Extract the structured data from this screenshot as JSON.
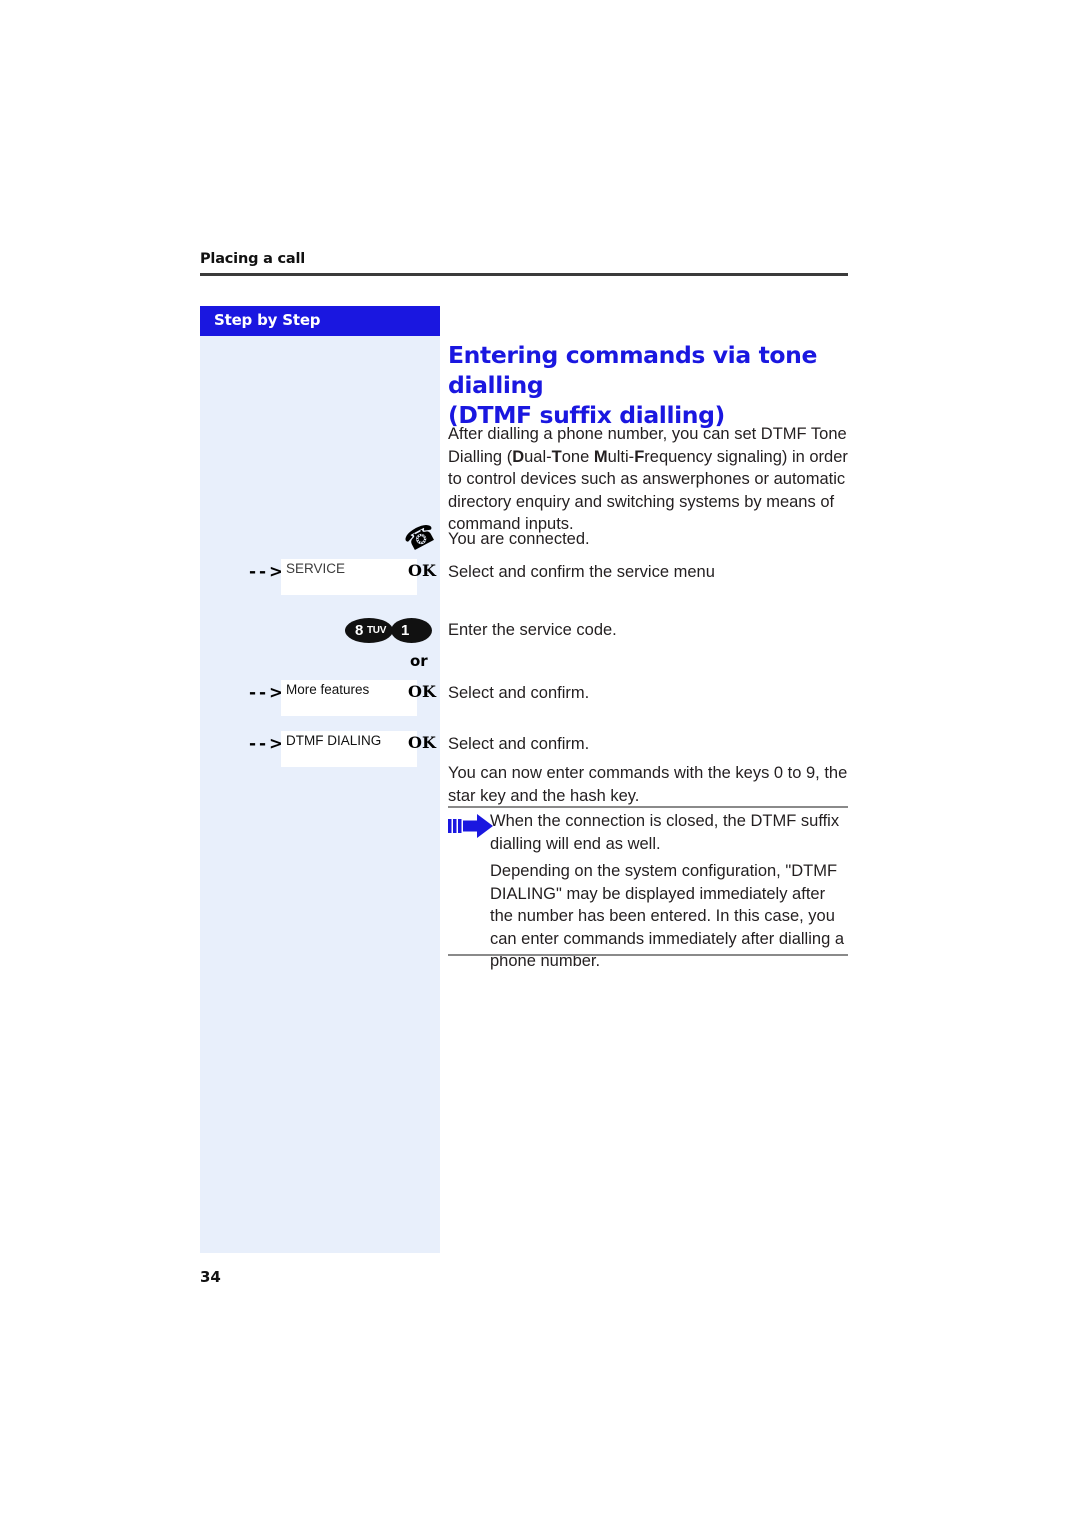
{
  "document": {
    "running_head": "Placing a call",
    "page_number": "34"
  },
  "sidebar": {
    "title": "Step by Step"
  },
  "main": {
    "heading_line1": "Entering commands via tone dialling",
    "heading_line2": "(DTMF suffix dialling)",
    "intro": {
      "line1_a": "After dialling a phone number, you can set DTMF Tone",
      "line2_a": "Dialling (",
      "line2_b": "D",
      "line2_c": "ual-",
      "line2_d": "T",
      "line2_e": "one ",
      "line2_f": "M",
      "line2_g": "ulti-",
      "line2_h": "F",
      "line2_i": "requency signaling) in order",
      "line3": "to control devices such as answerphones or automatic",
      "line4": "directory enquiry and switching systems by means of",
      "line5": "command inputs."
    },
    "closing_paragraph": "You can now enter commands with the keys 0 to 9, the star key and the hash key."
  },
  "steps": [
    {
      "id": "connected",
      "icon": "handset-icon",
      "text": "You are connected."
    },
    {
      "id": "service-menu",
      "select_arrow": "- - >",
      "display_value": "SERVICE",
      "softkey": "OK",
      "text": "Select and confirm the service menu"
    },
    {
      "id": "service-code",
      "keys": [
        {
          "digit": "8",
          "letters": "TUV"
        },
        {
          "digit": "1",
          "letters": ""
        }
      ],
      "text": "Enter the service code."
    },
    {
      "id": "or-separator",
      "label": "or"
    },
    {
      "id": "more-features",
      "select_arrow": "- - >",
      "display_value": "More features",
      "softkey": "OK",
      "text": "Select and confirm."
    },
    {
      "id": "dtmf-dialing",
      "select_arrow": "- - >",
      "display_value": "DTMF DIALING",
      "softkey": "OK",
      "text": "Select and confirm."
    }
  ],
  "note": {
    "icon": "blue-arrow-note-icon",
    "paragraph1": "When the connection is closed, the DTMF suffix dialling will end as well.",
    "paragraph2": "Depending on the system configuration, \"DTMF DIALING\" may be displayed immediately after the number has been entered. In this case, you can enter commands immediately after dialling a phone number."
  },
  "colors": {
    "brand_blue": "#1a17e0",
    "sidebar_tint": "#e8effb",
    "rule_grey": "#8a8a8a",
    "key_black": "#111111"
  }
}
